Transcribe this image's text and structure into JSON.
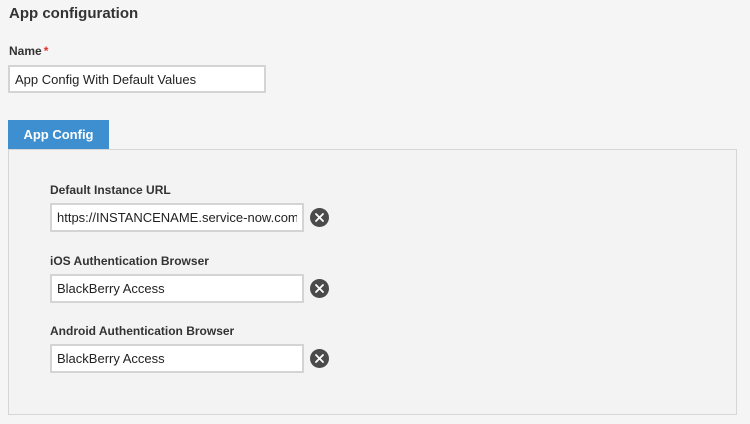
{
  "page": {
    "title": "App configuration"
  },
  "name_field": {
    "label": "Name",
    "required_marker": "*",
    "value": "App Config With Default Values"
  },
  "tab": {
    "label": "App Config"
  },
  "fields": [
    {
      "label": "Default Instance URL",
      "value": "https://INSTANCENAME.service-now.com",
      "clear_icon": "close-circle-icon"
    },
    {
      "label": "iOS Authentication Browser",
      "value": "BlackBerry Access",
      "clear_icon": "close-circle-icon"
    },
    {
      "label": "Android Authentication Browser",
      "value": "BlackBerry Access",
      "clear_icon": "close-circle-icon"
    }
  ],
  "colors": {
    "tab_bg": "#3d8fcf",
    "required": "#d9342b",
    "clear_button": "#4a4a4a"
  }
}
